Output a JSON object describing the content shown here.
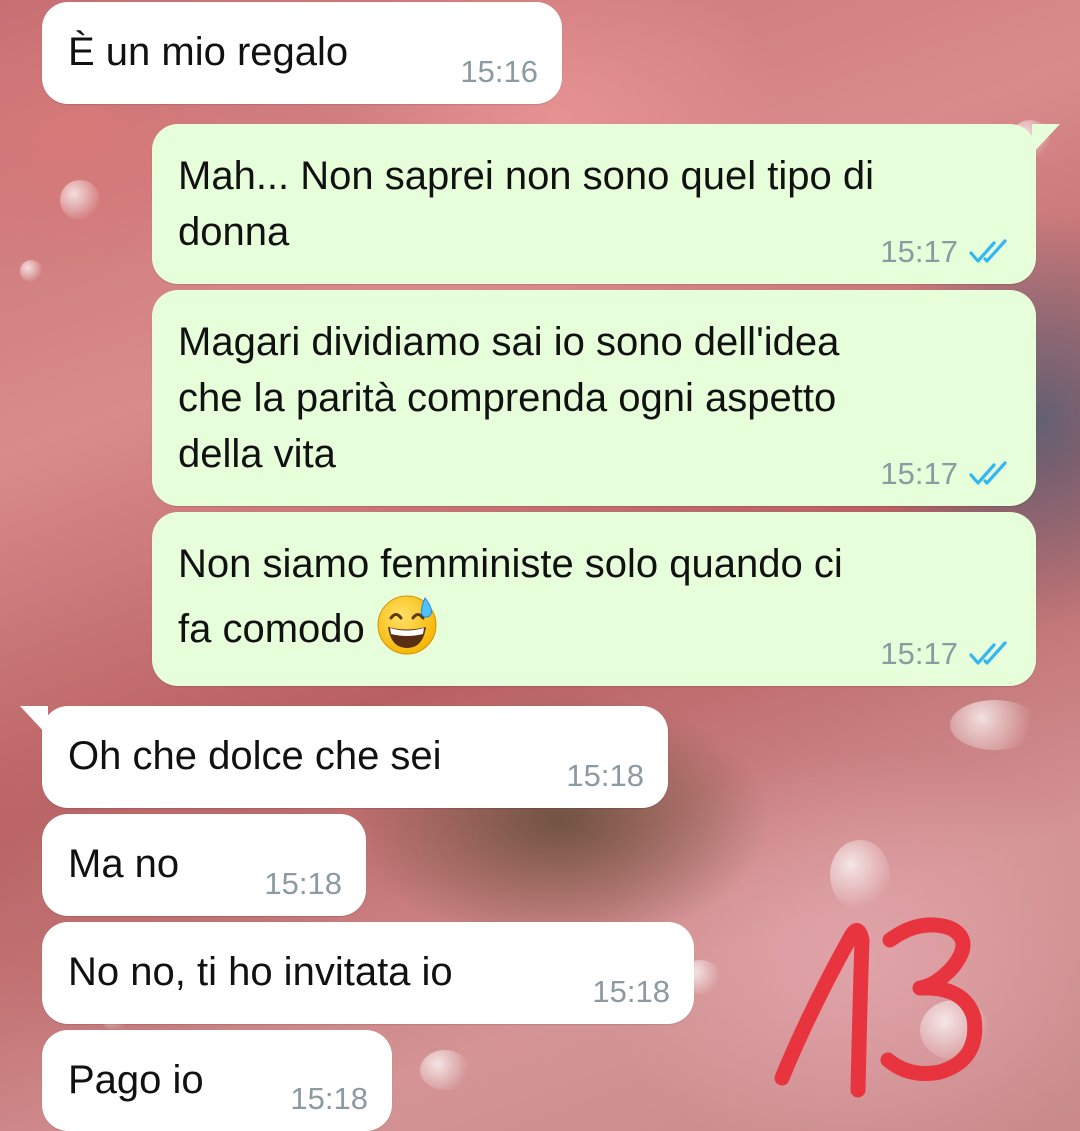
{
  "messages": [
    {
      "direction": "incoming",
      "text": "È un mio regalo",
      "time": "15:16"
    },
    {
      "direction": "outgoing",
      "text": "Mah... Non saprei non sono quel tipo di\ndonna",
      "time": "15:17",
      "status": "read"
    },
    {
      "direction": "outgoing",
      "text": "Magari dividiamo sai io sono dell'idea\nche la parità comprenda ogni aspetto\ndella vita",
      "time": "15:17",
      "status": "read"
    },
    {
      "direction": "outgoing",
      "text": "Non siamo femministe solo quando ci\nfa comodo",
      "emoji": "grinning-face-with-sweat",
      "time": "15:17",
      "status": "read"
    },
    {
      "direction": "incoming",
      "text": "Oh che dolce che sei",
      "time": "15:18"
    },
    {
      "direction": "incoming",
      "text": "Ma no",
      "time": "15:18"
    },
    {
      "direction": "incoming",
      "text": "No no, ti ho invitata io",
      "time": "15:18"
    },
    {
      "direction": "incoming",
      "text": "Pago io",
      "time": "15:18"
    }
  ],
  "overlay": {
    "page_number": "13",
    "color": "#e8343f"
  },
  "colors": {
    "incoming_bubble": "#ffffff",
    "outgoing_bubble": "#e6ffda",
    "read_ticks": "#34b7f1",
    "timestamp": "#8c9aa2"
  },
  "icons": {
    "read_status": "double-check-icon",
    "emoji": "grinning-face-with-sweat-emoji"
  }
}
